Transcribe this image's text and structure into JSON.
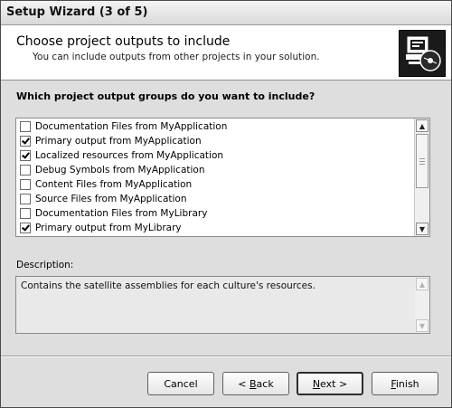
{
  "window": {
    "title": "Setup Wizard (3 of 5)"
  },
  "header": {
    "title": "Choose project outputs to include",
    "subtitle": "You can include outputs from other projects in your solution.",
    "icon": "computer-disk-icon"
  },
  "question": "Which project output groups do you want to include?",
  "output_groups": [
    {
      "label": "Documentation Files from MyApplication",
      "checked": false
    },
    {
      "label": "Primary output from MyApplication",
      "checked": true
    },
    {
      "label": "Localized resources from MyApplication",
      "checked": true
    },
    {
      "label": "Debug Symbols from MyApplication",
      "checked": false
    },
    {
      "label": "Content Files from MyApplication",
      "checked": false
    },
    {
      "label": "Source Files from MyApplication",
      "checked": false
    },
    {
      "label": "Documentation Files from MyLibrary",
      "checked": false
    },
    {
      "label": "Primary output from MyLibrary",
      "checked": true
    }
  ],
  "description": {
    "label": "Description:",
    "text": "Contains the satellite assemblies for each culture's resources."
  },
  "buttons": {
    "cancel": "Cancel",
    "back_pre": "< ",
    "back_key": "B",
    "back_post": "ack",
    "next_key": "N",
    "next_post": "ext >",
    "finish_key": "F",
    "finish_post": "inish"
  }
}
